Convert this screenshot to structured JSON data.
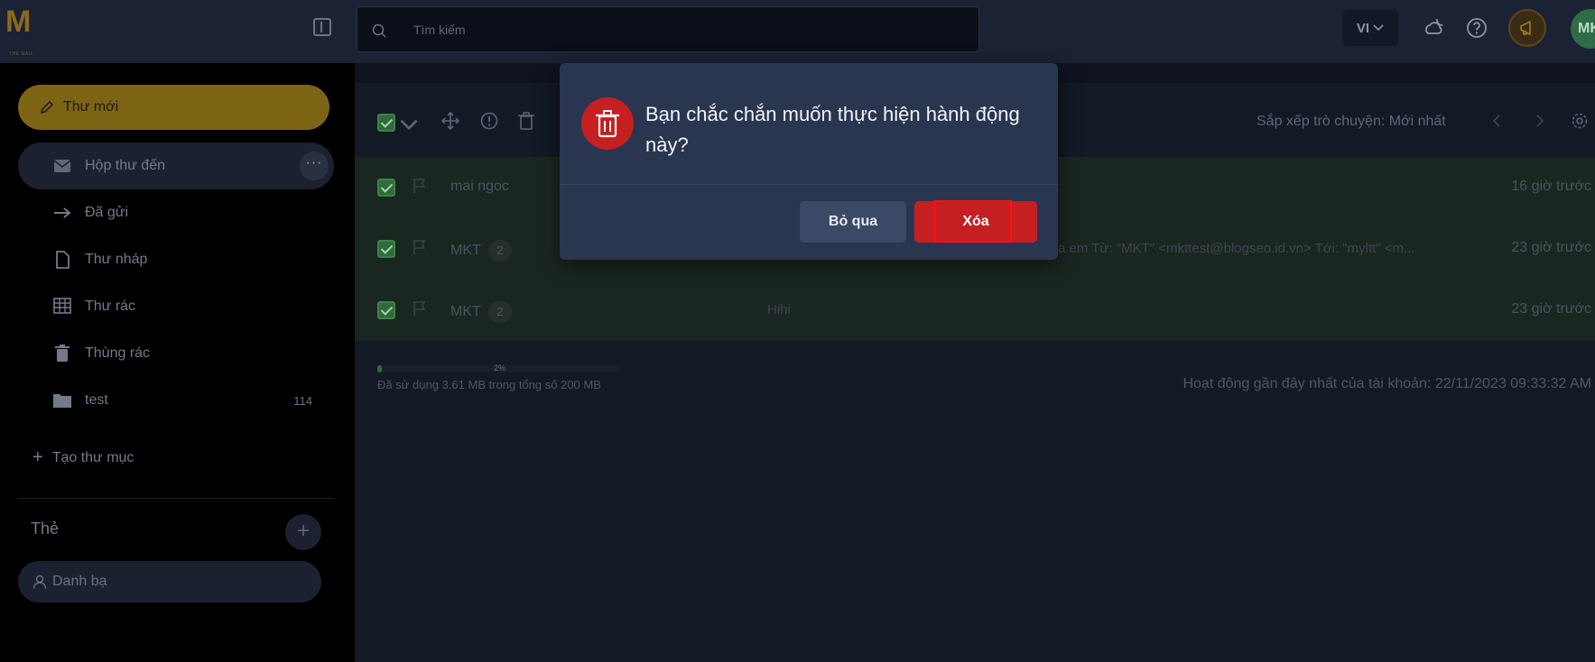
{
  "header": {
    "search_placeholder": "Tìm kiếm",
    "language": "VI",
    "avatar_initials": "MK"
  },
  "sidebar": {
    "compose_label": "Thư mới",
    "items": [
      {
        "label": "Hộp thư đến",
        "icon": "inbox-icon"
      },
      {
        "label": "Đã gửi",
        "icon": "send-icon"
      },
      {
        "label": "Thư nháp",
        "icon": "draft-icon"
      },
      {
        "label": "Thư rác",
        "icon": "spam-icon"
      },
      {
        "label": "Thùng rác",
        "icon": "trash-icon"
      },
      {
        "label": "test",
        "icon": "folder-icon",
        "count": "114"
      }
    ],
    "new_folder_label": "Tạo thư mục",
    "tags_title": "Thẻ",
    "contacts_label": "Danh bạ"
  },
  "toolbar": {
    "sort_label": "Sắp xếp trò chuyện: Mới nhất"
  },
  "mail_list": [
    {
      "from": "mai ngoc",
      "count": "",
      "subject": "",
      "time": "16 giờ trước",
      "checked": true
    },
    {
      "from": "MKT",
      "count": "2",
      "subject": "a em Từ: \"MKT\" <mkttest@blogseo.id.vn> Tới: \"myltt\" <m...",
      "time": "23 giờ trước",
      "checked": true
    },
    {
      "from": "MKT",
      "count": "2",
      "subject": "Hihi",
      "time": "23 giờ trước",
      "checked": true
    }
  ],
  "storage": {
    "percent_label": "2%",
    "percent_value": 2,
    "text": "Đã sử dụng 3.61 MB trong tổng số 200 MB"
  },
  "activity": "Hoạt động gần đây nhất của tài khoản: 22/11/2023 09:33:32 AM",
  "dialog": {
    "message": "Bạn chắc chắn muốn thực hiện hành động này?",
    "cancel_label": "Bỏ qua",
    "confirm_label": "Xóa"
  },
  "colors": {
    "danger": "#c51f22",
    "compose": "#7d6415",
    "checkbox": "#2f6b3a"
  }
}
